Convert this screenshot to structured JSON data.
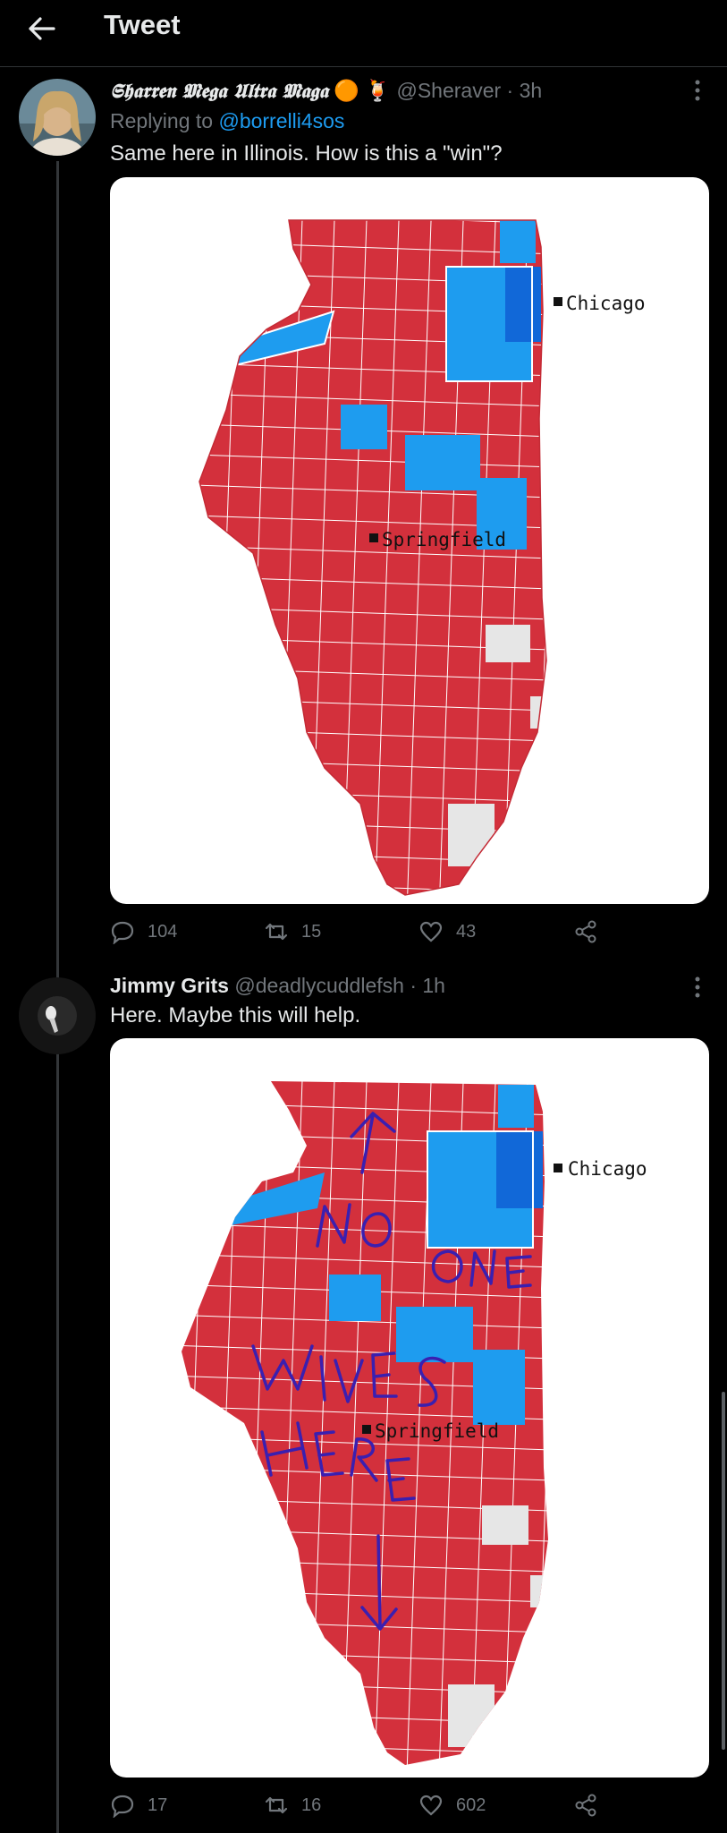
{
  "header": {
    "title": "Tweet",
    "back_icon": "arrow-left-icon"
  },
  "tweets": [
    {
      "display_name": "𝕾𝖍𝖆𝖗𝖗𝖊𝖓 𝕸𝖊𝖌𝖆 𝖀𝖑𝖙𝖗𝖆 𝕸𝖆𝖌𝖆",
      "emoji": "🟠 🍹",
      "handle": "@Sheraver",
      "time": "· 3h",
      "replying_prefix": "Replying to",
      "replying_to": "@borrelli4sos",
      "text": "Same here in Illinois. How is this a \"win\"?",
      "map_labels": {
        "chicago": "Chicago",
        "springfield": "Springfield"
      },
      "stats": {
        "replies": "104",
        "retweets": "15",
        "likes": "43"
      }
    },
    {
      "display_name": "Jimmy Grits",
      "handle": "@deadlycuddlefsh",
      "time": "· 1h",
      "text": "Here. Maybe this will help.",
      "map_labels": {
        "chicago": "Chicago",
        "springfield": "Springfield"
      },
      "handwritten_annotation": "NO ONE LIVES HERE",
      "stats": {
        "replies": "17",
        "retweets": "16",
        "likes": "602"
      }
    }
  ],
  "colors": {
    "red": "#d3303c",
    "light_blue": "#1e9cef",
    "dark_blue": "#1168d8",
    "gray": "#e6e6e6",
    "annotation": "#3a1fb0"
  }
}
